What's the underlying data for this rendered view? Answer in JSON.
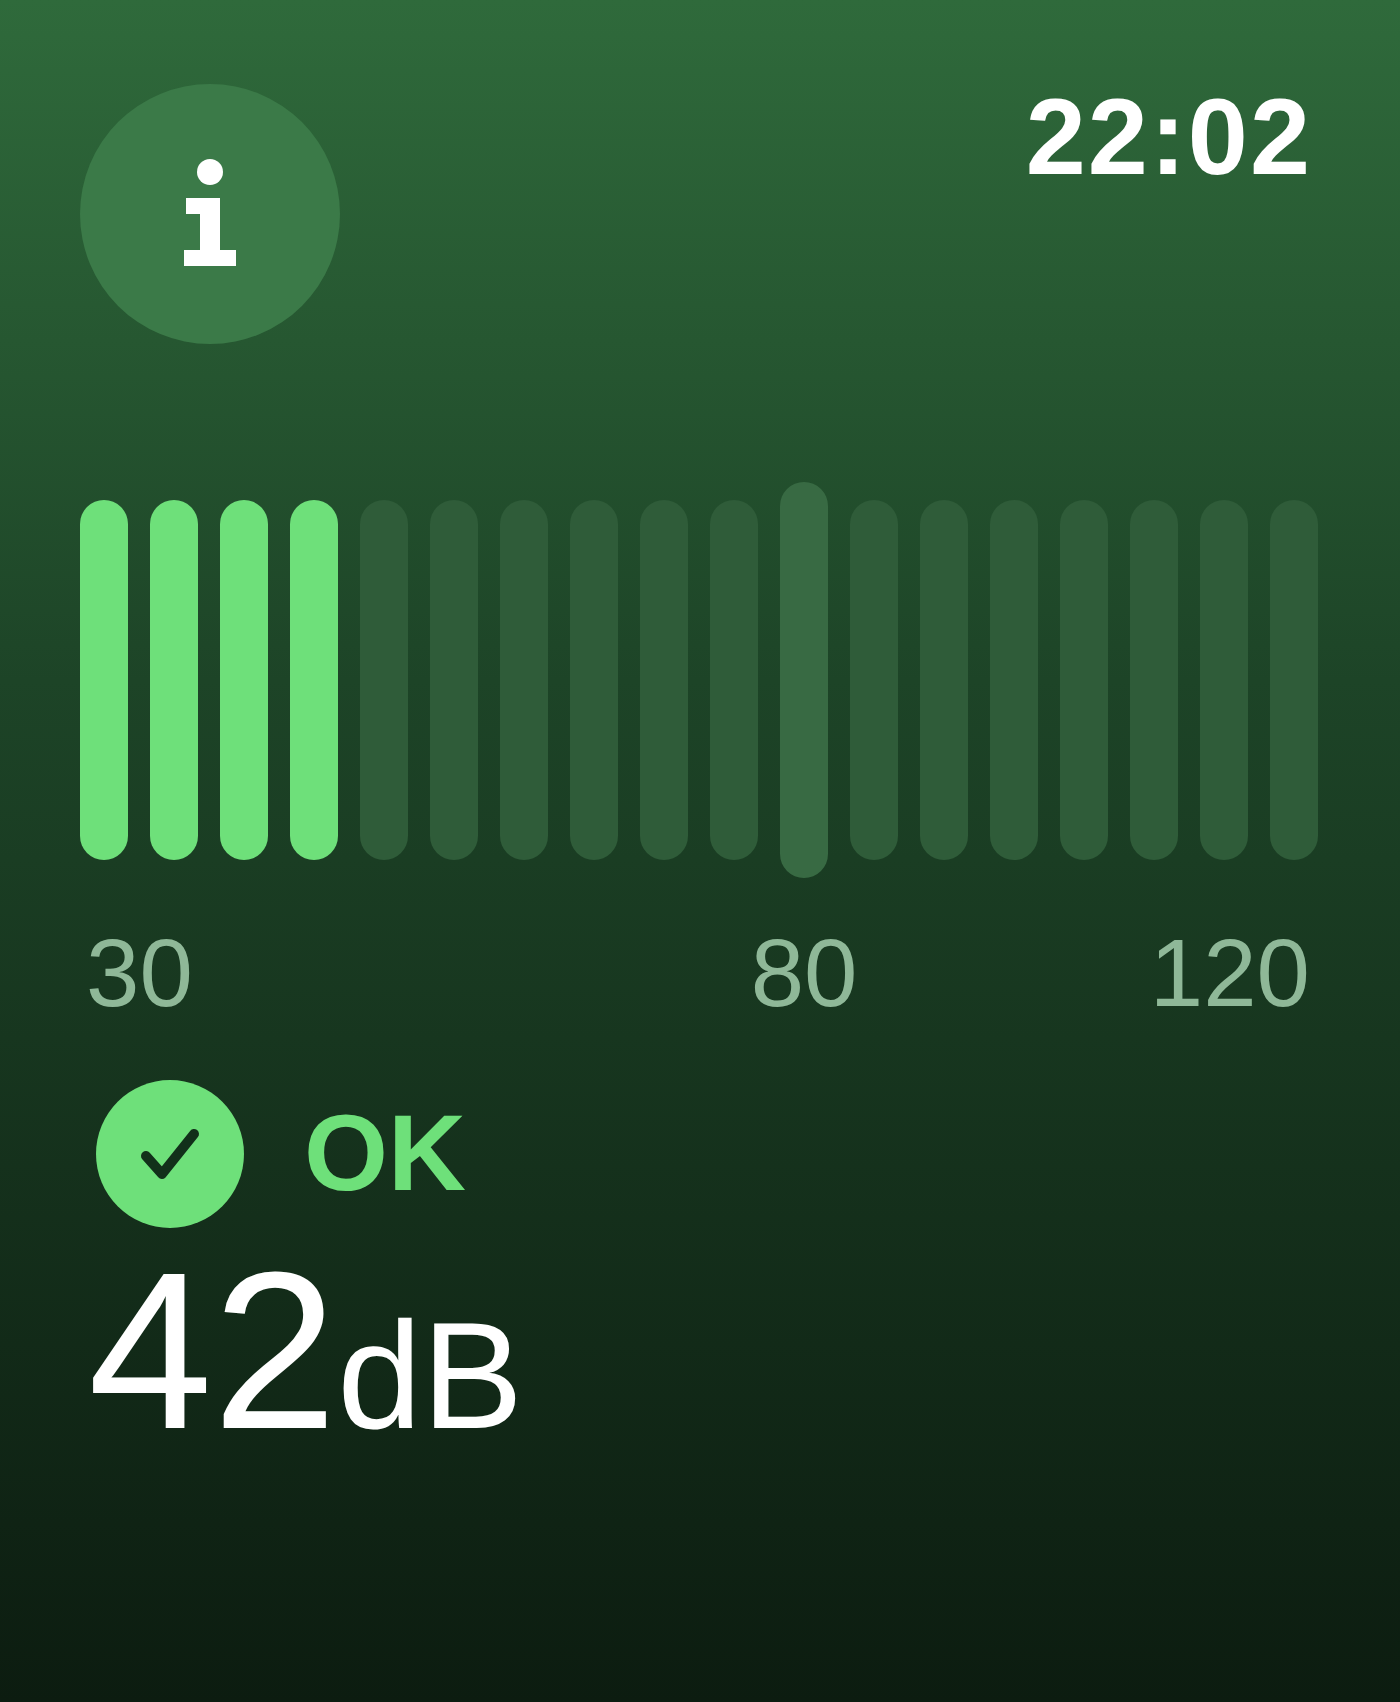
{
  "status_bar": {
    "time": "22:02"
  },
  "meter": {
    "bars": [
      {
        "lit": true,
        "marker": false
      },
      {
        "lit": true,
        "marker": false
      },
      {
        "lit": true,
        "marker": false
      },
      {
        "lit": true,
        "marker": false
      },
      {
        "lit": false,
        "marker": false
      },
      {
        "lit": false,
        "marker": false
      },
      {
        "lit": false,
        "marker": false
      },
      {
        "lit": false,
        "marker": false
      },
      {
        "lit": false,
        "marker": false
      },
      {
        "lit": false,
        "marker": false
      },
      {
        "lit": false,
        "marker": true
      },
      {
        "lit": false,
        "marker": false
      },
      {
        "lit": false,
        "marker": false
      },
      {
        "lit": false,
        "marker": false
      },
      {
        "lit": false,
        "marker": false
      },
      {
        "lit": false,
        "marker": false
      },
      {
        "lit": false,
        "marker": false
      },
      {
        "lit": false,
        "marker": false
      }
    ],
    "scale": [
      "30",
      "80",
      "120"
    ]
  },
  "status": {
    "kind": "ok",
    "label": "OK"
  },
  "reading": {
    "value": "42",
    "unit": "dB"
  }
}
